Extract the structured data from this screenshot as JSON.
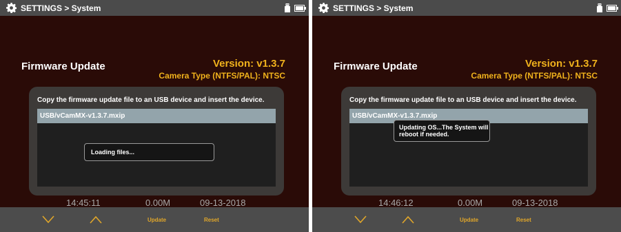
{
  "colors": {
    "background": "#2a0b07",
    "bar": "#4b4b4b",
    "accent": "#f0b21c",
    "selection": "#93a4ab",
    "panel": "#3d3a38"
  },
  "screens": [
    {
      "header": {
        "title": "SETTINGS > System",
        "icons": [
          "gear-icon",
          "usb-icon",
          "battery-icon"
        ]
      },
      "heading": "Firmware Update",
      "version": "Version: v1.3.7",
      "camera_type": "Camera Type (NTFS/PAL): NTSC",
      "instruction": "Copy the firmware update file to an USB device and insert the device.",
      "file": "USB/vCamMX-v1.3.7.mxip",
      "dialog": "Loading files...",
      "status": {
        "time": "14:45:11",
        "size": "0.00M",
        "date": "09-13-2018"
      },
      "buttons": {
        "down": "chevron-down-icon",
        "up": "chevron-up-icon",
        "update": "Update",
        "reset": "Reset"
      }
    },
    {
      "header": {
        "title": "SETTINGS > System",
        "icons": [
          "gear-icon",
          "usb-icon",
          "battery-icon"
        ]
      },
      "heading": "Firmware Update",
      "version": "Version: v1.3.7",
      "camera_type": "Camera Type (NTFS/PAL): NTSC",
      "instruction": "Copy the firmware update file to an USB device and insert the device.",
      "file": "USB/vCamMX-v1.3.7.mxip",
      "dialog": "Updating OS...The System will reboot if needed.",
      "status": {
        "time": "14:46:12",
        "size": "0.00M",
        "date": "09-13-2018"
      },
      "buttons": {
        "down": "chevron-down-icon",
        "up": "chevron-up-icon",
        "update": "Update",
        "reset": "Reset"
      }
    }
  ]
}
